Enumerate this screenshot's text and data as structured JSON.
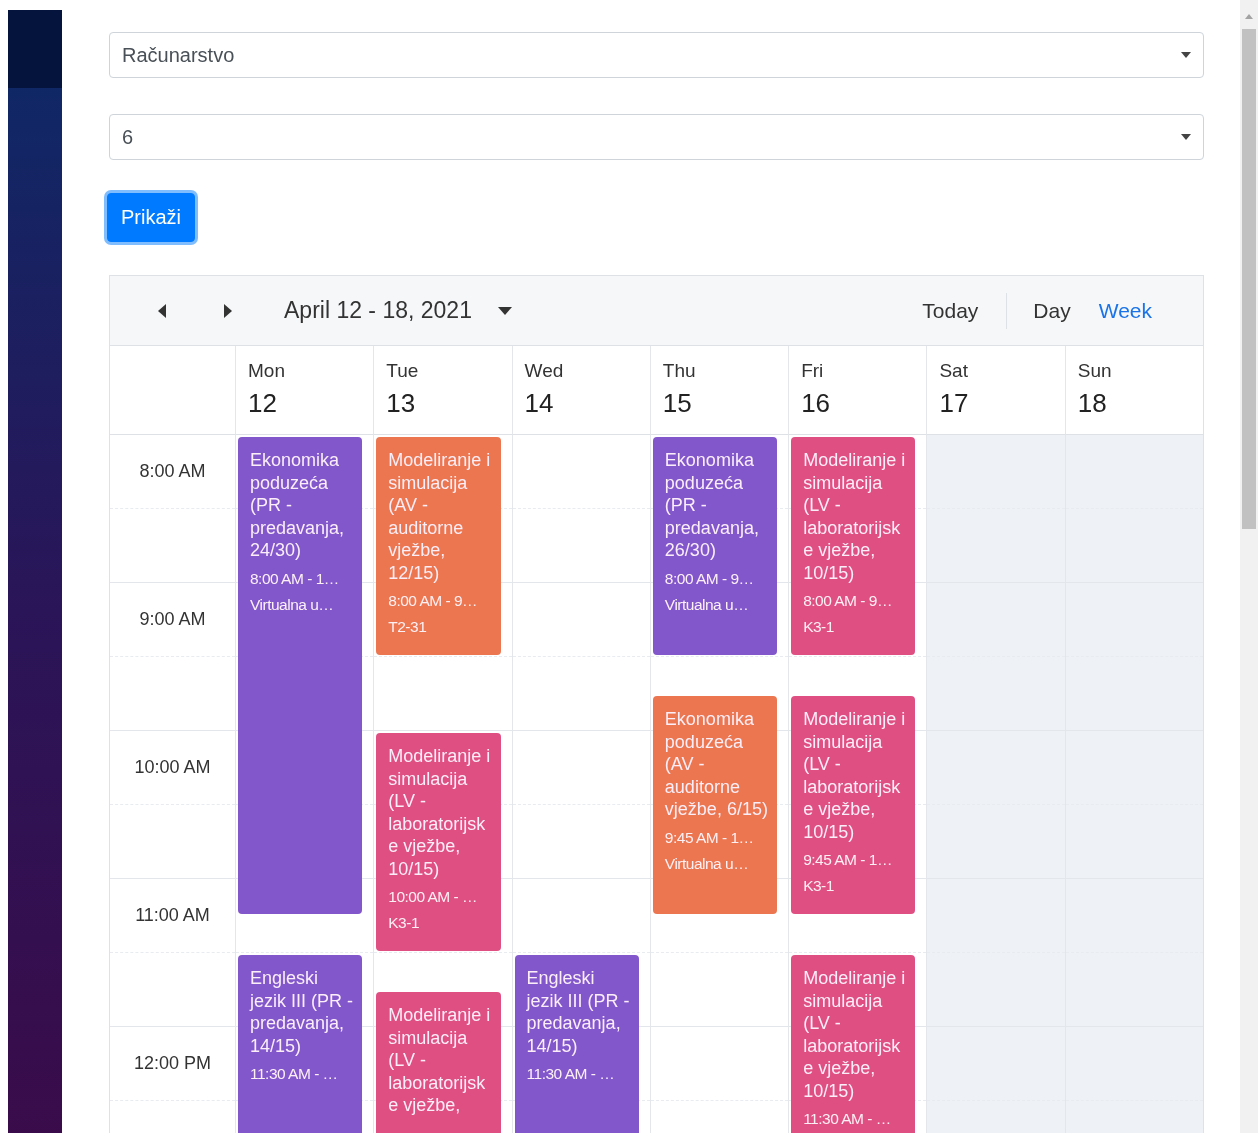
{
  "filters": [
    {
      "value": "Računarstvo"
    },
    {
      "value": "6"
    }
  ],
  "show_button": {
    "label": "Prikaži"
  },
  "calendar": {
    "range": "April 12 - 18, 2021",
    "today_button": "Today",
    "views": [
      {
        "label": "Day",
        "selected": false
      },
      {
        "label": "Week",
        "selected": true
      }
    ],
    "time_labels": [
      "8:00 AM",
      "9:00 AM",
      "10:00 AM",
      "11:00 AM",
      "12:00 PM"
    ],
    "days": [
      {
        "weekday": "Mon",
        "date": "12",
        "weekend": false,
        "events": [
          {
            "title": "Ekonomika poduzeća (PR - predavanja, 24/30)",
            "time": "8:00 AM - 1…",
            "place": "Virtualna u…",
            "color": "#8257cc"
          },
          {
            "title": "Engleski jezik III (PR - predavanja, 14/15)",
            "time": "11:30 AM - …",
            "color": "#8257cc"
          }
        ]
      },
      {
        "weekday": "Tue",
        "date": "13",
        "weekend": false,
        "events": [
          {
            "title": "Modeliranje i simulacija (AV - auditorne vježbe, 12/15)",
            "time": "8:00 AM - 9…",
            "place": "T2-31",
            "color": "#eb7650"
          },
          {
            "title": "Modeliranje i simulacija (LV - laboratorijske vježbe, 10/15)",
            "time": "10:00 AM - …",
            "place": "K3-1",
            "color": "#e04f82"
          },
          {
            "title": "Modeliranje i simulacija (LV - laboratorijske vježbe,",
            "color": "#e04f82"
          }
        ]
      },
      {
        "weekday": "Wed",
        "date": "14",
        "weekend": false,
        "events": [
          {
            "title": "Engleski jezik III (PR - predavanja, 14/15)",
            "time": "11:30 AM - …",
            "color": "#8257cc"
          }
        ]
      },
      {
        "weekday": "Thu",
        "date": "15",
        "weekend": false,
        "events": [
          {
            "title": "Ekonomika poduzeća (PR - predavanja, 26/30)",
            "time": "8:00 AM - 9…",
            "place": "Virtualna u…",
            "color": "#8257cc"
          },
          {
            "title": "Ekonomika poduzeća (AV - auditorne vježbe, 6/15)",
            "time": "9:45 AM - 1…",
            "place": "Virtualna u…",
            "color": "#eb7650"
          }
        ]
      },
      {
        "weekday": "Fri",
        "date": "16",
        "weekend": false,
        "events": [
          {
            "title": "Modeliranje i simulacija (LV - laboratorijske vježbe, 10/15)",
            "time": "8:00 AM - 9…",
            "place": "K3-1",
            "color": "#e04f82"
          },
          {
            "title": "Modeliranje i simulacija (LV - laboratorijske vježbe, 10/15)",
            "time": "9:45 AM - 1…",
            "place": "K3-1",
            "color": "#e04f82"
          },
          {
            "title": "Modeliranje i simulacija (LV - laboratorijske vježbe, 10/15)",
            "time": "11:30 AM - …",
            "color": "#e04f82"
          }
        ]
      },
      {
        "weekday": "Sat",
        "date": "17",
        "weekend": true
      },
      {
        "weekday": "Sun",
        "date": "18",
        "weekend": true
      }
    ]
  }
}
